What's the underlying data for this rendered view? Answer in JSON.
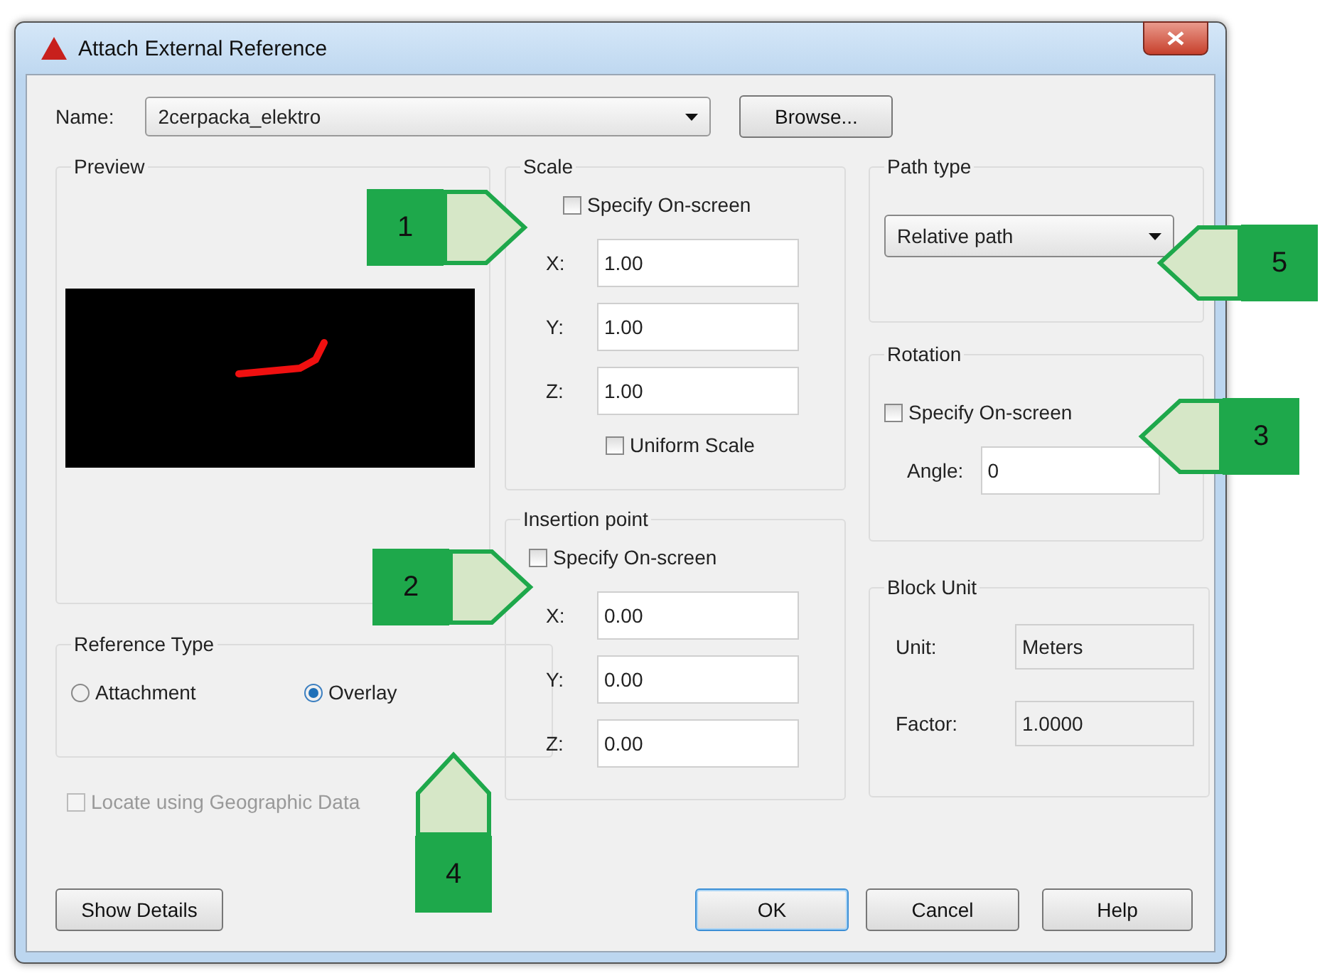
{
  "window": {
    "title": "Attach External Reference"
  },
  "name_field": {
    "label": "Name:",
    "value": "2cerpacka_elektro"
  },
  "browse_button": {
    "label": "Browse..."
  },
  "preview": {
    "title": "Preview"
  },
  "reference_type": {
    "title": "Reference Type",
    "options": [
      {
        "label": "Attachment",
        "selected": false
      },
      {
        "label": "Overlay",
        "selected": true
      }
    ]
  },
  "geographic": {
    "label": "Locate using Geographic Data",
    "checked": false,
    "disabled": true
  },
  "scale": {
    "title": "Scale",
    "specify": {
      "label": "Specify On-screen",
      "checked": false
    },
    "fields": [
      {
        "label": "X:",
        "value": "1.00"
      },
      {
        "label": "Y:",
        "value": "1.00"
      },
      {
        "label": "Z:",
        "value": "1.00"
      }
    ],
    "uniform": {
      "label": "Uniform Scale",
      "checked": false
    }
  },
  "insertion_point": {
    "title": "Insertion point",
    "specify": {
      "label": "Specify On-screen",
      "checked": false
    },
    "fields": [
      {
        "label": "X:",
        "value": "0.00"
      },
      {
        "label": "Y:",
        "value": "0.00"
      },
      {
        "label": "Z:",
        "value": "0.00"
      }
    ]
  },
  "path_type": {
    "title": "Path type",
    "value": "Relative path"
  },
  "rotation": {
    "title": "Rotation",
    "specify": {
      "label": "Specify On-screen",
      "checked": false
    },
    "angle": {
      "label": "Angle:",
      "value": "0"
    }
  },
  "block_unit": {
    "title": "Block Unit",
    "rows": [
      {
        "label": "Unit:",
        "value": "Meters"
      },
      {
        "label": "Factor:",
        "value": "1.0000"
      }
    ]
  },
  "buttons": [
    {
      "label": "Show Details",
      "default": false
    },
    {
      "label": "OK",
      "default": true
    },
    {
      "label": "Cancel",
      "default": false
    },
    {
      "label": "Help",
      "default": false
    }
  ],
  "callouts": [
    {
      "number": "1",
      "kind": "right"
    },
    {
      "number": "2",
      "kind": "right"
    },
    {
      "number": "3",
      "kind": "left"
    },
    {
      "number": "4",
      "kind": "up"
    },
    {
      "number": "5",
      "kind": "left"
    }
  ]
}
